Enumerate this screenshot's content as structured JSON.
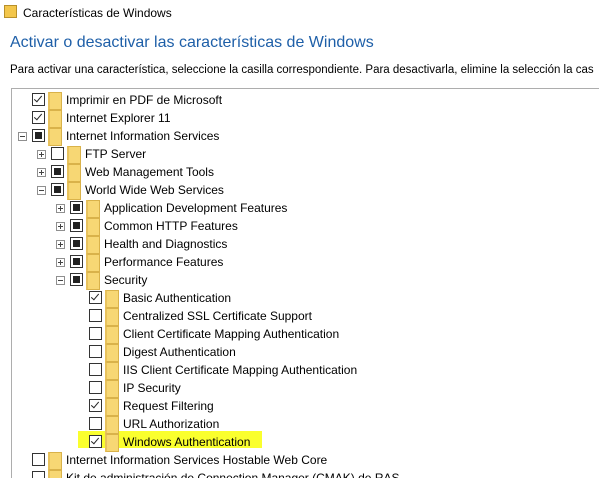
{
  "window": {
    "title": "Características de Windows"
  },
  "header": {
    "heading": "Activar o desactivar las características de Windows",
    "instructions": "Para activar una característica, seleccione la casilla correspondiente. Para desactivarla, elimine la selección la cas"
  },
  "tree": {
    "items": [
      {
        "label": "Imprimir en PDF de Microsoft",
        "state": "checked"
      },
      {
        "label": "Internet Explorer 11",
        "state": "checked"
      },
      {
        "label": "Internet Information Services",
        "state": "partial",
        "expanded": true
      },
      {
        "label": "FTP Server",
        "state": "unchecked",
        "expanded": false
      },
      {
        "label": "Web Management Tools",
        "state": "partial",
        "expanded": false
      },
      {
        "label": "World Wide Web Services",
        "state": "partial",
        "expanded": true
      },
      {
        "label": "Application Development Features",
        "state": "partial",
        "expanded": false
      },
      {
        "label": "Common HTTP Features",
        "state": "partial",
        "expanded": false
      },
      {
        "label": "Health and Diagnostics",
        "state": "partial",
        "expanded": false
      },
      {
        "label": "Performance Features",
        "state": "partial",
        "expanded": false
      },
      {
        "label": "Security",
        "state": "partial",
        "expanded": true
      },
      {
        "label": "Basic Authentication",
        "state": "checked"
      },
      {
        "label": "Centralized SSL Certificate Support",
        "state": "unchecked"
      },
      {
        "label": "Client Certificate Mapping Authentication",
        "state": "unchecked"
      },
      {
        "label": "Digest Authentication",
        "state": "unchecked"
      },
      {
        "label": "IIS Client Certificate Mapping Authentication",
        "state": "unchecked"
      },
      {
        "label": "IP Security",
        "state": "unchecked"
      },
      {
        "label": "Request Filtering",
        "state": "checked"
      },
      {
        "label": "URL Authorization",
        "state": "unchecked"
      },
      {
        "label": "Windows Authentication",
        "state": "checked",
        "highlighted": true
      },
      {
        "label": "Internet Information Services Hostable Web Core",
        "state": "unchecked"
      },
      {
        "label": "Kit de administración de Connection Manager (CMAK) de RAS",
        "state": "unchecked"
      }
    ]
  },
  "colors": {
    "heading": "#1e5fa8",
    "highlight": "#faff2e",
    "folder": "#f7d774"
  }
}
